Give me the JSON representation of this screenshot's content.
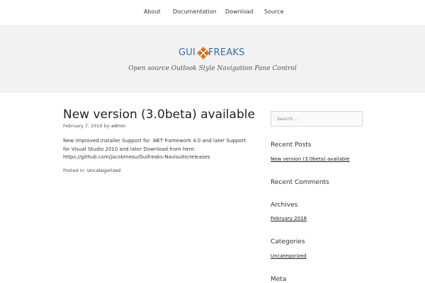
{
  "nav": {
    "items": [
      "About",
      "Documentation",
      "Download",
      "Source"
    ]
  },
  "header": {
    "logo_left": "GUI",
    "logo_right": "FREAKS",
    "tagline": "Open source Outlook Style Navigation Pane Control",
    "colors": {
      "logo_text": "#3b6ea5",
      "logo_mark": "#e07b1f",
      "band_bg": "#f2f2f2"
    }
  },
  "post": {
    "title": "New version (3.0beta) available",
    "date": "February 7, 2016",
    "by": "by",
    "author": "admin",
    "body": "New improved installer Support for .NET framework 4.0 and later Support for Visual Studio 2010 and later Download from here: https://github.com/jacobmesu/Guifreaks-Navisuite/releases",
    "posted_in_label": "Posted in:",
    "category": "Uncategorized"
  },
  "sidebar": {
    "search_placeholder": "Search ...",
    "recent_posts_title": "Recent Posts",
    "recent_posts": [
      "New version (3.0beta) available"
    ],
    "recent_comments_title": "Recent Comments",
    "archives_title": "Archives",
    "archives": [
      "February 2016"
    ],
    "categories_title": "Categories",
    "categories": [
      "Uncategorized"
    ],
    "meta_title": "Meta"
  }
}
